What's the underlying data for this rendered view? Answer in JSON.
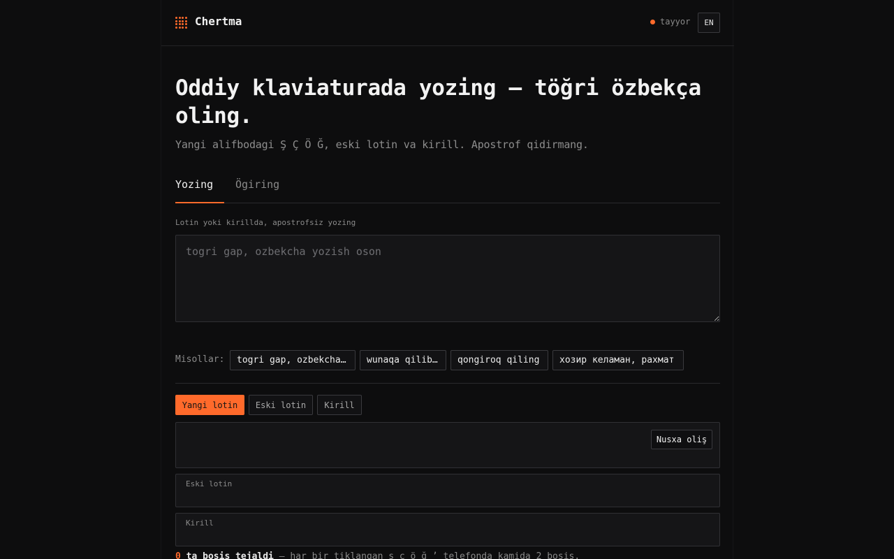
{
  "app": {
    "name": "Chertma"
  },
  "status": {
    "text": "tayyor",
    "color": "#ff6a2b"
  },
  "language_button": {
    "label": "EN"
  },
  "hero": {
    "title": "Oddiy klaviaturada yozing — töğri özbekça oling.",
    "subtitle": "Yangi alifbodagi Ş Ç Ö Ğ, eski lotin va kirill. Apostrof qidirmang."
  },
  "tabs": [
    {
      "label": "Yozing",
      "active": true
    },
    {
      "label": "Ögiring",
      "active": false
    }
  ],
  "input": {
    "label": "Lotin yoki kirillda, apostrofsiz yozing",
    "placeholder": "togri gap, ozbekcha yozish oson",
    "value": ""
  },
  "examples": {
    "label": "Misollar:",
    "items": [
      "togri gap, ozbekcha…",
      "wunaqa qilib…",
      "qongiroq qiling",
      "хозир келаман, рахмат"
    ]
  },
  "output_modes": [
    {
      "label": "Yangi lotin",
      "active": true
    },
    {
      "label": "Eski lotin",
      "active": false
    },
    {
      "label": "Kirill",
      "active": false
    }
  ],
  "output": {
    "copy_label": "Nusxa oliş",
    "main_value": "",
    "old_latin": {
      "label": "Eski lotin",
      "value": ""
    },
    "cyrillic": {
      "label": "Kirill",
      "value": ""
    }
  },
  "footer": {
    "count": "0",
    "count_label": "ta bosis tejaldi",
    "detail": " — har bir tiklangan ş ç ö ğ ʼ telefonda kamida 2 bosis."
  },
  "colors": {
    "accent": "#ff6a2b",
    "background": "#0d0d0e",
    "panel": "#151517"
  }
}
